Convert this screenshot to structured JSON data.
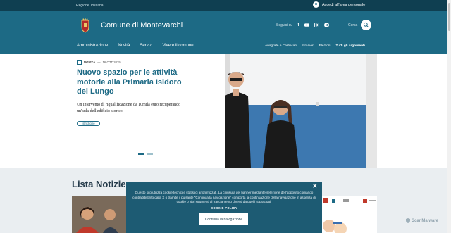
{
  "topbar": {
    "region": "Regione Toscana",
    "login_label": "Accedi all'area personale"
  },
  "header": {
    "site_title": "Comune di Montevarchi",
    "follow_label": "Seguici su",
    "social_icons": [
      "facebook-icon",
      "youtube-icon",
      "instagram-icon",
      "telegram-icon"
    ],
    "search_label": "Cerca"
  },
  "nav": {
    "main": [
      "Amministrazione",
      "Novità",
      "Servizi",
      "Vivere il comune"
    ],
    "secondary": [
      "Anagrafe e Certificati",
      "Stranieri",
      "Elezioni"
    ],
    "all_topics": "Tutti gli argomenti..."
  },
  "hero": {
    "category": "NOVITÀ",
    "separator": "—",
    "date": "16 OTT 2025",
    "headline": "Nuovo spazio per le attività motorie alla Primaria Isidoro del Lungo",
    "description": "Un intervento di riqualificazione da 10mila euro recuperando un'aula dell'edificio storico",
    "tag": "Istruzione",
    "slides_total": 2,
    "slide_active": 1
  },
  "news": {
    "section_title": "Lista Notizie"
  },
  "cookie_banner": {
    "text": "Questo sito utilizza cookie tecnici e statistici anonimizzati. La chiusura del banner mediante selezione dell'apposito comando contraddistinto dalla X o tramite il pulsante \"Continua la navigazione\" comporta la continuazione della navigazione in assenza di cookie o altri strumenti di tracciamento diversi da quelli sopracitati.",
    "policy_label": "COOKIE POLICY",
    "accept_label": "Continua la navigazione",
    "close_label": "✕"
  },
  "watermark": "ScanMalware",
  "colors": {
    "primary": "#1d6a85",
    "topbar": "#0f3f51",
    "cookie_bg": "#1d5b73",
    "section_bg": "#eaeef1"
  }
}
